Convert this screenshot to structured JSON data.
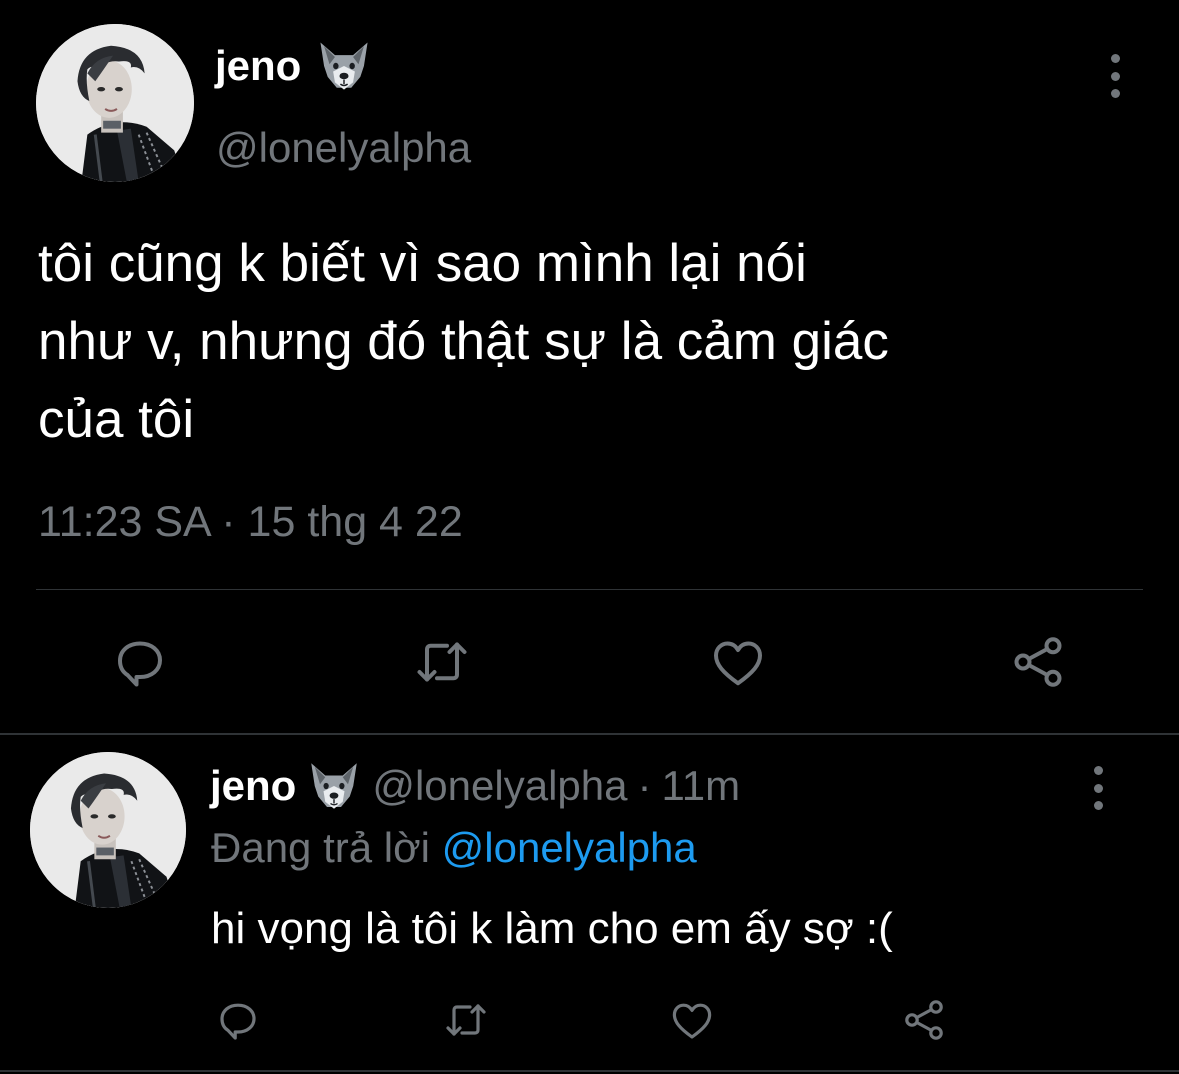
{
  "colors": {
    "background": "#000000",
    "primary_text": "#ffffff",
    "secondary_text": "#71767b",
    "accent": "#1d9bf0",
    "divider": "#2f3336"
  },
  "main_tweet": {
    "display_name": "jeno",
    "name_emoji": "wolf-emoji",
    "handle": "@lonelyalpha",
    "text": "tôi cũng k biết vì sao mình lại nói\nnhư v, nhưng đó thật sự là cảm giác\ncủa tôi",
    "timestamp": "11:23 SA · 15 thg 4 22",
    "actions": [
      "reply-icon",
      "retweet-icon",
      "like-icon",
      "share-icon"
    ]
  },
  "reply_tweet": {
    "display_name": "jeno",
    "name_emoji": "wolf-emoji",
    "handle": "@lonelyalpha",
    "separator": "·",
    "time": "11m",
    "replying_to_label": "Đang trả lời",
    "replying_to_handle": "@lonelyalpha",
    "text": "hi vọng là tôi k làm cho em ấy sợ :(",
    "actions": [
      "reply-icon",
      "retweet-icon",
      "like-icon",
      "share-icon"
    ]
  }
}
